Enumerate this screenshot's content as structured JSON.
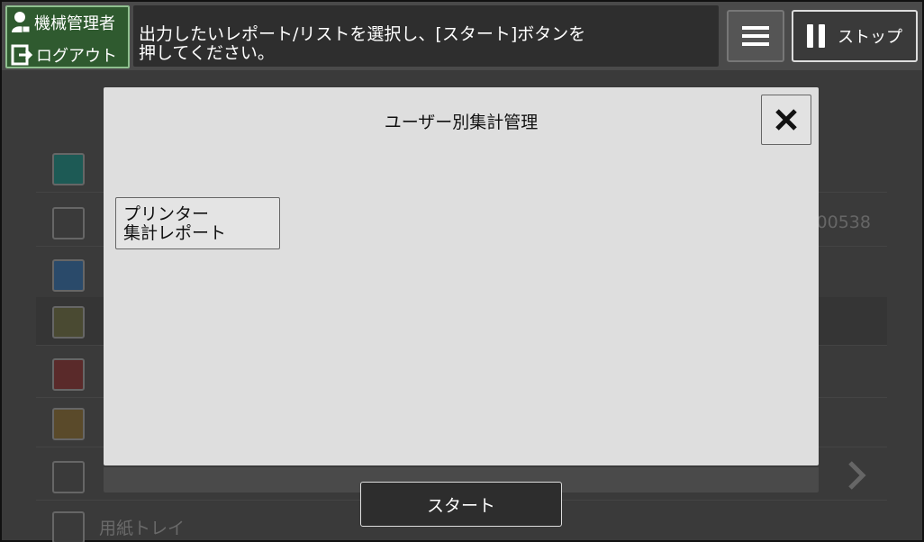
{
  "header": {
    "admin_label": "機械管理者",
    "logout_label": "ログアウト",
    "message_line1": "出力したいレポート/リストを選択し、[スタート]ボタンを",
    "message_line2": "押してください。",
    "stop_label": "ストップ"
  },
  "background": {
    "value_text": "00538",
    "last_item_label": "用紙トレイ"
  },
  "modal": {
    "title": "ユーザー別集計管理",
    "report_button_line1": "プリンター",
    "report_button_line2": "集計レポート"
  },
  "footer": {
    "start_label": "スタート"
  }
}
